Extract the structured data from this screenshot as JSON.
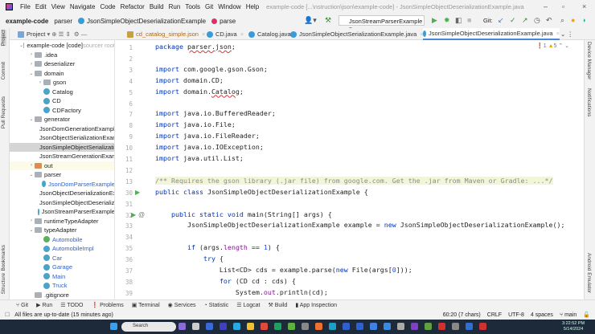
{
  "window": {
    "title": "example-code [...\\nstruction\\json\\example-code] - JsonSimpleObjectDeserializationExample.java",
    "minimize": "–",
    "maximize": "▫",
    "close": "×"
  },
  "menu": [
    "File",
    "Edit",
    "View",
    "Navigate",
    "Code",
    "Refactor",
    "Build",
    "Run",
    "Tools",
    "Git",
    "Window",
    "Help"
  ],
  "breadcrumb": {
    "project": "example-code",
    "package": "parser",
    "class": "JsonSimpleObjectDeserializationExample",
    "method": "parse"
  },
  "run_config": "JsonStreamParserExample",
  "git_label": "Git:",
  "project_panel": {
    "label": "Project"
  },
  "tabs": [
    {
      "label": "cd_catalog_simple.json"
    },
    {
      "label": "CD.java"
    },
    {
      "label": "Catalog.java"
    },
    {
      "label": "JsonSimpleObjectSerializationExample.java"
    },
    {
      "label": "JsonSimpleObjectDeserializationExample.java",
      "active": true
    }
  ],
  "left_stripe": [
    "Project",
    "Commit",
    "Pull Requests",
    "Bookmarks",
    "Structure"
  ],
  "right_stripe": [
    "Device Manager",
    "Notifications",
    "Android Emulator"
  ],
  "tree": [
    {
      "label": "example-code [code]",
      "suffix": " sourcer root",
      "level": 0,
      "type": "module",
      "expanded": true
    },
    {
      "label": ".idea",
      "level": 1,
      "type": "folder",
      "expanded": false
    },
    {
      "label": "deserializer",
      "level": 1,
      "type": "folder",
      "expanded": false
    },
    {
      "label": "domain",
      "level": 1,
      "type": "folder",
      "expanded": true
    },
    {
      "label": "gson",
      "level": 2,
      "type": "folder",
      "expanded": false
    },
    {
      "label": "Catalog",
      "level": 2,
      "type": "class"
    },
    {
      "label": "CD",
      "level": 2,
      "type": "class"
    },
    {
      "label": "CDFactory",
      "level": 2,
      "type": "class"
    },
    {
      "label": "generator",
      "level": 1,
      "type": "folder",
      "expanded": true
    },
    {
      "label": "JsonDomGenerationExample",
      "level": 2,
      "type": "class"
    },
    {
      "label": "JsonObjectSerializationExample",
      "level": 2,
      "type": "class"
    },
    {
      "label": "JsonSimpleObjectSerializationExample",
      "level": 2,
      "type": "class",
      "selected": true
    },
    {
      "label": "JsonStreamGenerationExample",
      "level": 2,
      "type": "class"
    },
    {
      "label": "out",
      "level": 1,
      "type": "folder-orange",
      "expanded": false
    },
    {
      "label": "parser",
      "level": 1,
      "type": "folder",
      "expanded": true
    },
    {
      "label": "JsonDomParserExample",
      "level": 2,
      "type": "class",
      "color": "#2f63c8"
    },
    {
      "label": "JsonObjectDeserializationExample",
      "level": 2,
      "type": "class"
    },
    {
      "label": "JsonSimpleObjectDeserializationExample",
      "level": 2,
      "type": "class"
    },
    {
      "label": "JsonStreamParserExample",
      "level": 2,
      "type": "class"
    },
    {
      "label": "runtimeTypeAdapter",
      "level": 1,
      "type": "folder",
      "expanded": false
    },
    {
      "label": "typeAdapter",
      "level": 1,
      "type": "folder",
      "expanded": true
    },
    {
      "label": "Automobile",
      "level": 2,
      "type": "interface",
      "color": "#2f63c8"
    },
    {
      "label": "AutomobileImpl",
      "level": 2,
      "type": "class",
      "color": "#2f63c8"
    },
    {
      "label": "Car",
      "level": 2,
      "type": "class",
      "color": "#2f63c8"
    },
    {
      "label": "Garage",
      "level": 2,
      "type": "class",
      "color": "#2f63c8"
    },
    {
      "label": "Main",
      "level": 2,
      "type": "class",
      "color": "#2f63c8"
    },
    {
      "label": "Truck",
      "level": 2,
      "type": "class",
      "color": "#2f63c8"
    },
    {
      "label": ".gitignore",
      "level": 1,
      "type": "file"
    }
  ],
  "inspections": {
    "errors": "1",
    "warnings": "5"
  },
  "code": [
    {
      "n": "1",
      "s": [
        [
          "package ",
          "kw"
        ],
        [
          "parser.json",
          "err"
        ],
        [
          ";",
          ""
        ]
      ]
    },
    {
      "n": "2",
      "s": []
    },
    {
      "n": "3",
      "s": [
        [
          "import ",
          "kw"
        ],
        [
          "com.google.gson.Gson;",
          ""
        ]
      ]
    },
    {
      "n": "4",
      "s": [
        [
          "import ",
          "kw"
        ],
        [
          "domain.CD;",
          ""
        ]
      ]
    },
    {
      "n": "5",
      "s": [
        [
          "import ",
          "kw"
        ],
        [
          "domain.",
          ""
        ],
        [
          "Catalog",
          "err"
        ],
        [
          ";",
          ""
        ]
      ]
    },
    {
      "n": "6",
      "s": []
    },
    {
      "n": "7",
      "s": [
        [
          "import ",
          "kw"
        ],
        [
          "java.io.BufferedReader;",
          ""
        ]
      ]
    },
    {
      "n": "8",
      "s": [
        [
          "import ",
          "kw"
        ],
        [
          "java.io.File;",
          ""
        ]
      ]
    },
    {
      "n": "9",
      "s": [
        [
          "import ",
          "kw"
        ],
        [
          "java.io.FileReader;",
          ""
        ]
      ]
    },
    {
      "n": "10",
      "s": [
        [
          "import ",
          "kw"
        ],
        [
          "java.io.IOException;",
          ""
        ]
      ]
    },
    {
      "n": "11",
      "s": [
        [
          "import ",
          "kw"
        ],
        [
          "java.util.List;",
          ""
        ]
      ]
    },
    {
      "n": "12",
      "s": []
    },
    {
      "n": "13",
      "s": [
        [
          "/** Requires the gson library (.jar file) from google.com. Get the .jar from Maven or Gradle: ...*/",
          "cm"
        ]
      ]
    },
    {
      "n": "30",
      "s": [
        [
          "public class ",
          "kw"
        ],
        [
          "JsonSimpleObjectDeserializationExample {",
          ""
        ]
      ],
      "run": true
    },
    {
      "n": "31",
      "s": []
    },
    {
      "n": "32",
      "s": [
        [
          "    public static void ",
          "kw"
        ],
        [
          "main(String[] args) {",
          ""
        ]
      ],
      "run": true,
      "at": true
    },
    {
      "n": "33",
      "s": [
        [
          "        JsonSimpleObjectDeserializationExample example = ",
          ""
        ],
        [
          "new ",
          "kw"
        ],
        [
          "JsonSimpleObjectDeserializationExample();",
          ""
        ]
      ]
    },
    {
      "n": "34",
      "s": []
    },
    {
      "n": "35",
      "s": [
        [
          "        ",
          ""
        ],
        [
          "if ",
          "kw"
        ],
        [
          "(args.",
          ""
        ],
        [
          "length",
          "fld"
        ],
        [
          " == ",
          ""
        ],
        [
          "1",
          "num"
        ],
        [
          ") {",
          ""
        ]
      ]
    },
    {
      "n": "36",
      "s": [
        [
          "            ",
          ""
        ],
        [
          "try ",
          "kw"
        ],
        [
          "{",
          ""
        ]
      ]
    },
    {
      "n": "37",
      "s": [
        [
          "                List<CD> cds = example.parse(",
          ""
        ],
        [
          "new ",
          "kw"
        ],
        [
          "File(args[",
          ""
        ],
        [
          "0",
          "num"
        ],
        [
          "]));",
          ""
        ]
      ]
    },
    {
      "n": "38",
      "s": [
        [
          "                ",
          ""
        ],
        [
          "for ",
          "kw"
        ],
        [
          "(CD cd : cds) {",
          ""
        ]
      ]
    },
    {
      "n": "39",
      "s": [
        [
          "                    System.",
          ""
        ],
        [
          "out",
          "fld"
        ],
        [
          ".println(cd);",
          ""
        ]
      ]
    }
  ],
  "tool_windows": [
    "Git",
    "Run",
    "TODO",
    "Problems",
    "Terminal",
    "Services",
    "Statistic",
    "Logcat",
    "Build",
    "App Inspection"
  ],
  "status": {
    "message": "All files are up-to-date (15 minutes ago)",
    "position": "60:20 (7 chars)",
    "line_sep": "CRLF",
    "encoding": "UTF-8",
    "indent": "4 spaces",
    "branch": "main"
  },
  "taskbar": {
    "search_placeholder": "Search",
    "time": "3:22:52 PM",
    "date": "5/14/2024"
  },
  "colors": {
    "accent": "#4a88d9",
    "keyword": "#0033b3",
    "taskbar": "#1c2a3a"
  }
}
